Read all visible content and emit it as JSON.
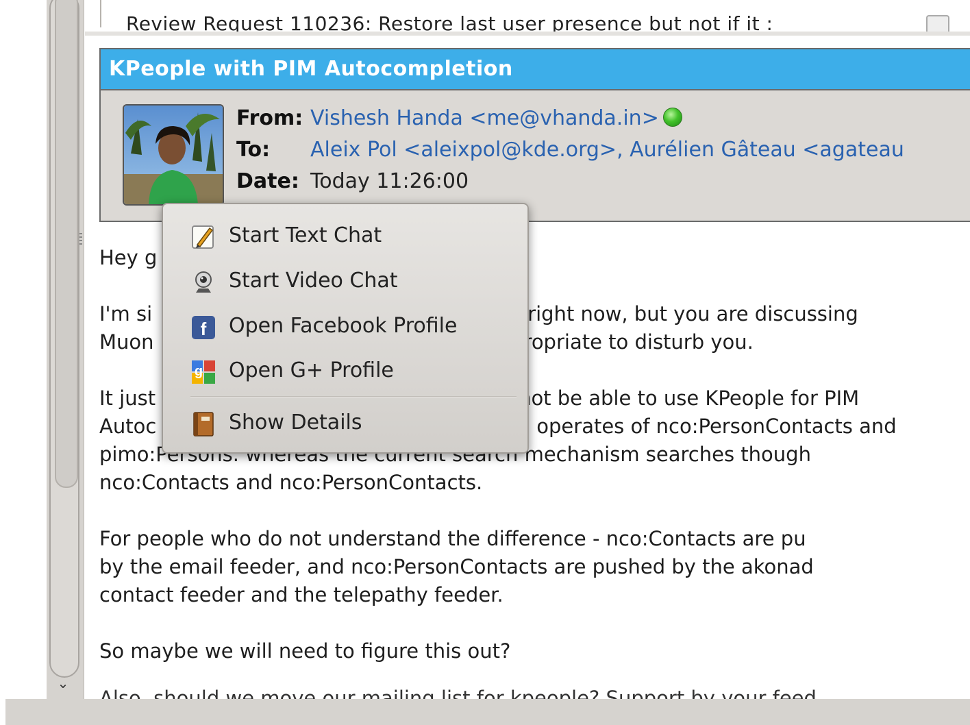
{
  "previous_message": {
    "subject": "Review Request 110236: Restore last user presence but not if it :"
  },
  "message": {
    "subject": "KPeople with PIM Autocompletion",
    "from_label": "From:",
    "from_value": "Vishesh Handa <me@vhanda.in>",
    "to_label": "To:",
    "to_value": "Aleix Pol <aleixpol@kde.org>, Aurélien Gâteau <agateau",
    "date_label": "Date:",
    "date_value": "Today 11:26:00",
    "presence_color": "#43c22b",
    "body": {
      "p1_visible_start": "Hey g",
      "p2_line1_left": "I'm si",
      "p2_line1_right": "right now, but you are discussing",
      "p2_line2_left": "Muon",
      "p2_line2_right": "ropriate to disturb you.",
      "p3_line1_left": "It just",
      "p3_line1_right": "not be able to use KPeople for PIM",
      "p3_line2_left": "Autoc",
      "p3_line2_right": "operates of nco:PersonContacts and",
      "p3_line3": "pimo:Persons. whereas the current search mechanism searches though",
      "p3_line4": "nco:Contacts and nco:PersonContacts.",
      "p4_line1": "For people who do not understand the difference - nco:Contacts are pu",
      "p4_line2": "by the email feeder, and nco:PersonContacts are pushed by the akonad",
      "p4_line3": "contact feeder and the telepathy feeder.",
      "p5_line1": "So maybe we will need to figure this out?",
      "p6_cut": "Also, should we move our mailing list for kpeople? Support by your feed"
    }
  },
  "context_menu": {
    "items": [
      {
        "label": "Start Text Chat",
        "icon": "pencil-chat-icon"
      },
      {
        "label": "Start Video Chat",
        "icon": "webcam-icon"
      },
      {
        "label": "Open Facebook Profile",
        "icon": "facebook-icon"
      },
      {
        "label": "Open G+ Profile",
        "icon": "google-plus-icon"
      },
      {
        "label": "Show Details",
        "icon": "address-book-icon"
      }
    ]
  },
  "colors": {
    "accent": "#3daee9",
    "link": "#2a62b0",
    "facebook": "#3b5998"
  }
}
